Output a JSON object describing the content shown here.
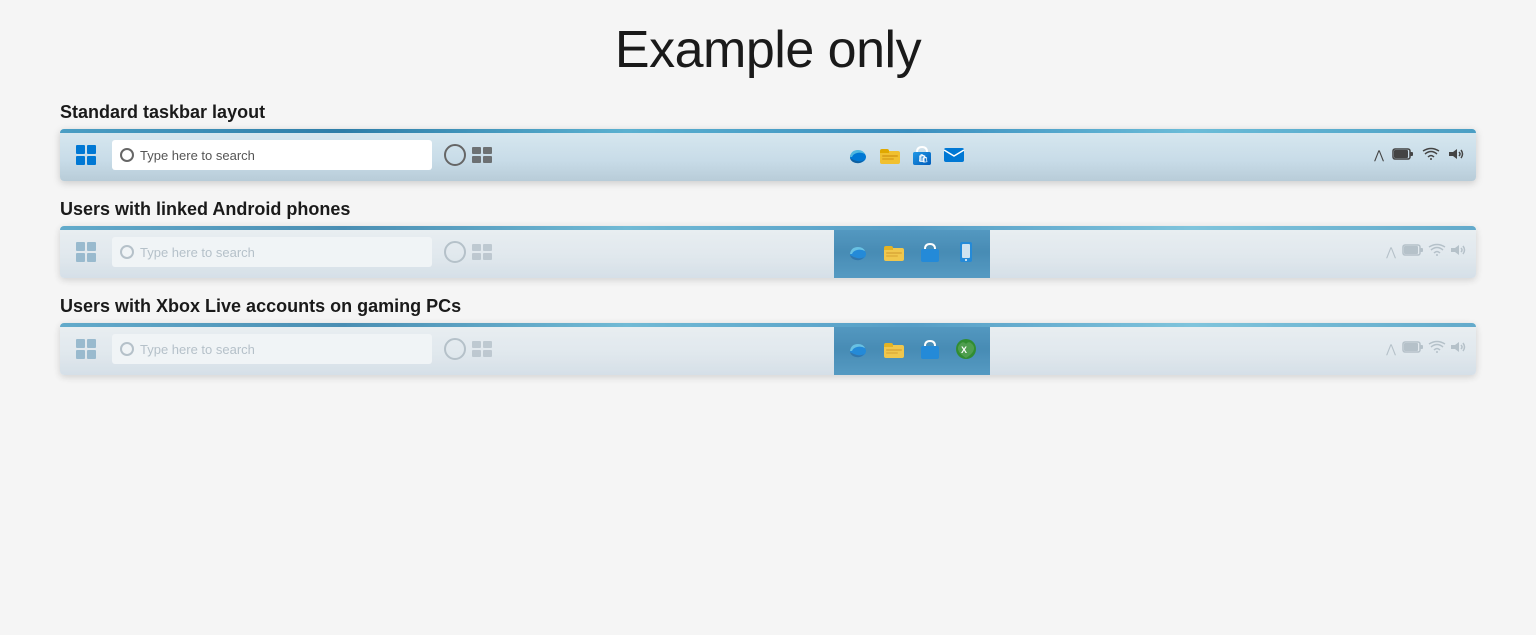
{
  "page": {
    "title": "Example only",
    "background": "#f5f5f5"
  },
  "sections": [
    {
      "id": "standard",
      "label": "Standard taskbar layout",
      "type": "standard",
      "faded": false,
      "highlighted": false
    },
    {
      "id": "android",
      "label": "Users with linked Android phones",
      "type": "android",
      "faded": true,
      "highlighted": true
    },
    {
      "id": "xbox",
      "label": "Users with Xbox Live accounts on gaming PCs",
      "type": "xbox",
      "faded": true,
      "highlighted": true
    }
  ],
  "search": {
    "placeholder": "Type here to search"
  },
  "tray": {
    "chevron": "^",
    "battery": "🔋",
    "wifi": "📶",
    "volume": "🔊"
  }
}
